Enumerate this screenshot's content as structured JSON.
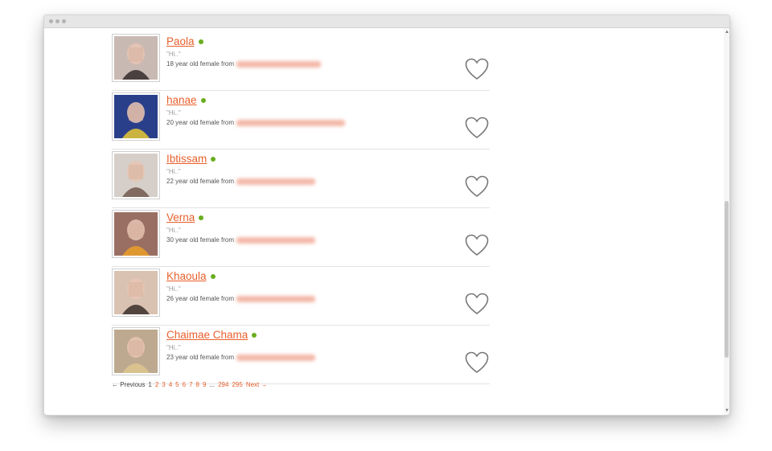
{
  "window": {
    "controls": [
      "dot",
      "dot",
      "dot"
    ]
  },
  "profiles": [
    {
      "name": "Paola",
      "greeting": "\"Hi..\"",
      "description": "18 year old female from",
      "location_blur_width": 105,
      "avatar_tone": "#c9b9b3",
      "avatar_accent": "#2b2222"
    },
    {
      "name": "hanae",
      "greeting": "\"Hi..\"",
      "description": "20 year old female from",
      "location_blur_width": 135,
      "avatar_tone": "#2a3f8a",
      "avatar_accent": "#f2d12e"
    },
    {
      "name": "Ibtissam",
      "greeting": "\"Hi..\"",
      "description": "22 year old female from",
      "location_blur_width": 98,
      "avatar_tone": "#d6cfc9",
      "avatar_accent": "#6b5147"
    },
    {
      "name": "Verna",
      "greeting": "\"Hi..\"",
      "description": "30 year old female from",
      "location_blur_width": 98,
      "avatar_tone": "#9a6f63",
      "avatar_accent": "#f0a123"
    },
    {
      "name": "Khaoula",
      "greeting": "\"Hi..\"",
      "description": "26 year old female from",
      "location_blur_width": 98,
      "avatar_tone": "#d9c2b2",
      "avatar_accent": "#2f2420"
    },
    {
      "name": "Chaimae Chama",
      "greeting": "\"Hi..\"",
      "description": "23 year old female from",
      "location_blur_width": 98,
      "avatar_tone": "#bda98f",
      "avatar_accent": "#e0c88d"
    }
  ],
  "pagination": {
    "previous": "← Previous",
    "current": "1",
    "pages": [
      "2",
      "3",
      "4",
      "5",
      "6",
      "7",
      "8",
      "9"
    ],
    "ellipsis": "...",
    "tail_pages": [
      "294",
      "295"
    ],
    "next": "Next →"
  },
  "colors": {
    "link": "#e8602c",
    "online": "#6aad1f",
    "heart_outline": "#777777"
  }
}
